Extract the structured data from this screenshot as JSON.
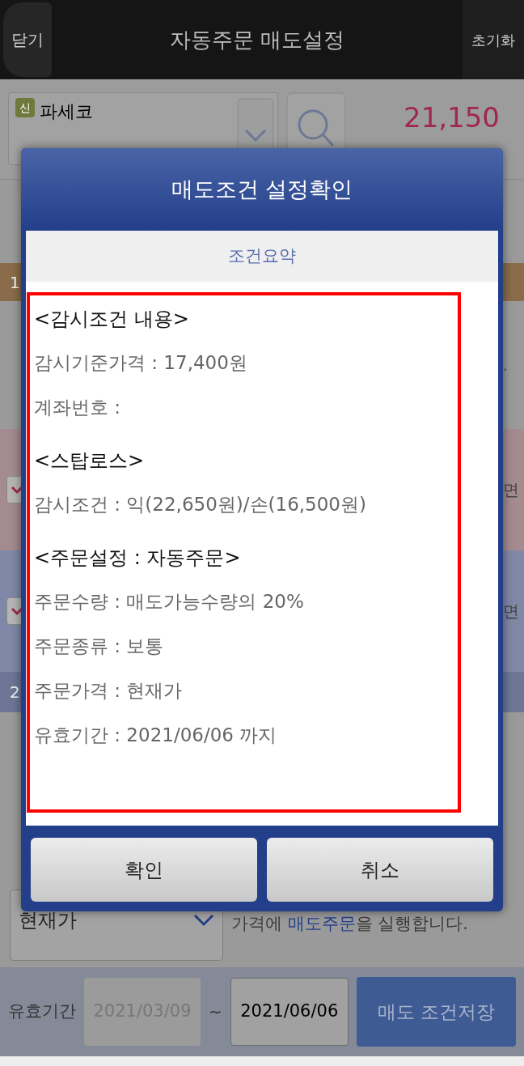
{
  "header": {
    "close": "닫기",
    "title": "자동주문 매도설정",
    "reset": "초기화"
  },
  "stock": {
    "badge": "신",
    "name": "파세코",
    "price": "21,150"
  },
  "background": {
    "section_1": "1",
    "dot": ".",
    "rows": [
      {
        "kind": "pink",
        "checked": true,
        "tail": "면"
      },
      {
        "kind": "lavender",
        "checked": true,
        "tail": "면"
      }
    ],
    "section_2": "2"
  },
  "order_price": {
    "select": "현재가",
    "prefix": "가격에",
    "link": "매도주문",
    "suffix": "을 실행합니다."
  },
  "validity": {
    "label": "유효기간",
    "start": "2021/03/09",
    "start_disabled": true,
    "separator": "~",
    "end": "2021/06/06",
    "save": "매도 조건저장"
  },
  "dialog": {
    "title": "매도조건 설정확인",
    "subtitle": "조건요약",
    "lines": [
      {
        "kind": "heading",
        "text": "<감시조건 내용>"
      },
      {
        "kind": "item",
        "text": "감시기준가격 : 17,400원"
      },
      {
        "kind": "item",
        "text": "계좌번호 :"
      },
      {
        "kind": "heading",
        "text": "<스탑로스>"
      },
      {
        "kind": "item",
        "text": "감시조건 : 익(22,650원)/손(16,500원)"
      },
      {
        "kind": "heading",
        "text": "<주문설정 : 자동주문>"
      },
      {
        "kind": "item",
        "text": "주문수량 : 매도가능수량의 20%"
      },
      {
        "kind": "item",
        "text": "주문종류 : 보통"
      },
      {
        "kind": "item",
        "text": "주문가격 : 현재가"
      },
      {
        "kind": "item",
        "text": "유효기간 : 2021/06/06 까지"
      }
    ],
    "buttons": [
      "확인",
      "취소"
    ]
  }
}
